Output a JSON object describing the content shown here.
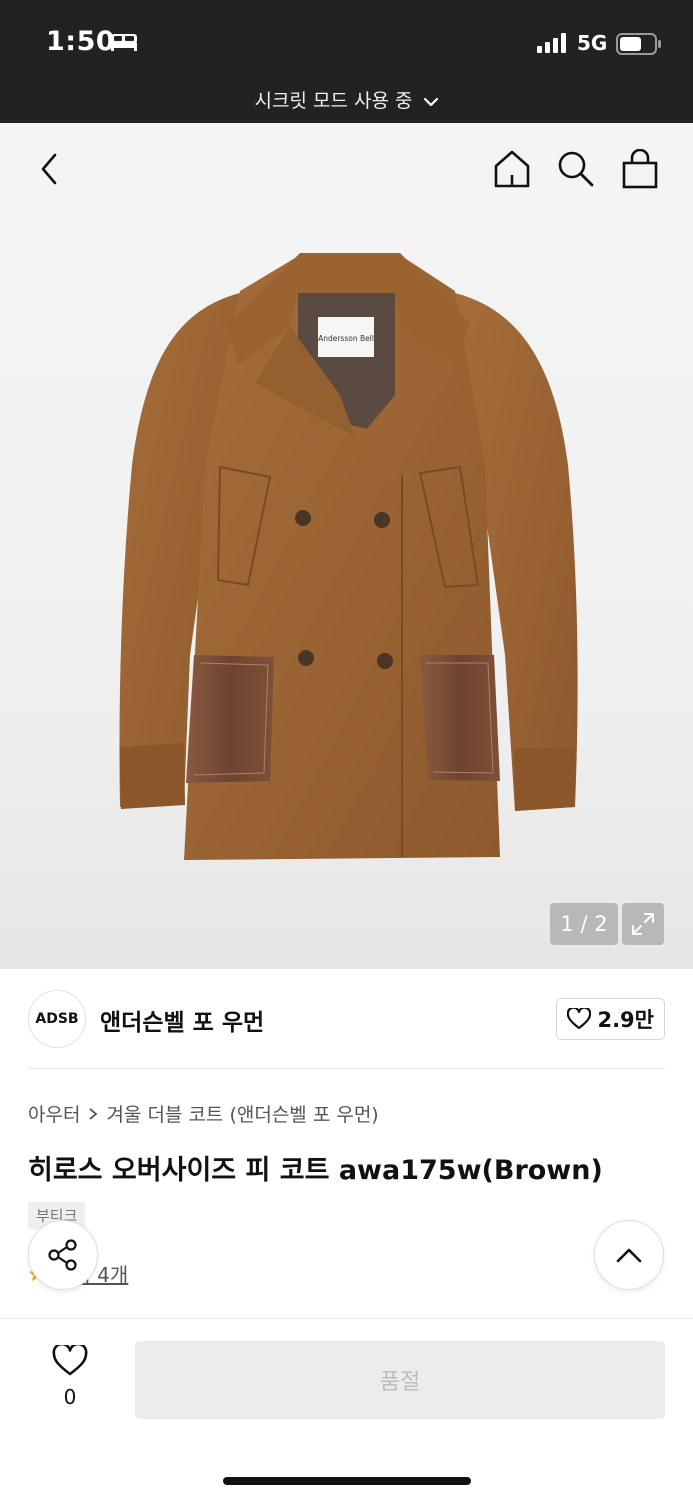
{
  "status_bar": {
    "time": "1:50",
    "network": "5G",
    "incognito_label": "시크릿 모드 사용 중",
    "icons": [
      "bed-icon",
      "signal-icon",
      "battery-icon",
      "chevron-down-icon"
    ]
  },
  "nav": {
    "icons": [
      "back-icon",
      "home-icon",
      "search-icon",
      "shopping-bag-icon"
    ]
  },
  "gallery": {
    "image": "brown double-breasted coat with leather pockets",
    "label_text": "Andersson Bell",
    "pager": "1 / 2",
    "expand_icon": "expand-icon"
  },
  "brand": {
    "logo_text": "ADSB",
    "name": "앤더슨벨 포 우먼",
    "likes": "2.9만"
  },
  "product": {
    "breadcrumb": [
      "아우터",
      "겨울 더블 코트 (앤더슨벨 포 우먼)"
    ],
    "title": "히로스 오버사이즈 피 코트 awa175w(Brown)",
    "tag": "부티크",
    "review_link": "후기 4개"
  },
  "bottom": {
    "wish_count": "0",
    "buy_label": "품절"
  },
  "colors": {
    "status_bg": "#222222",
    "coat_brown": "#9a6232",
    "leather": "#7a4a32"
  }
}
